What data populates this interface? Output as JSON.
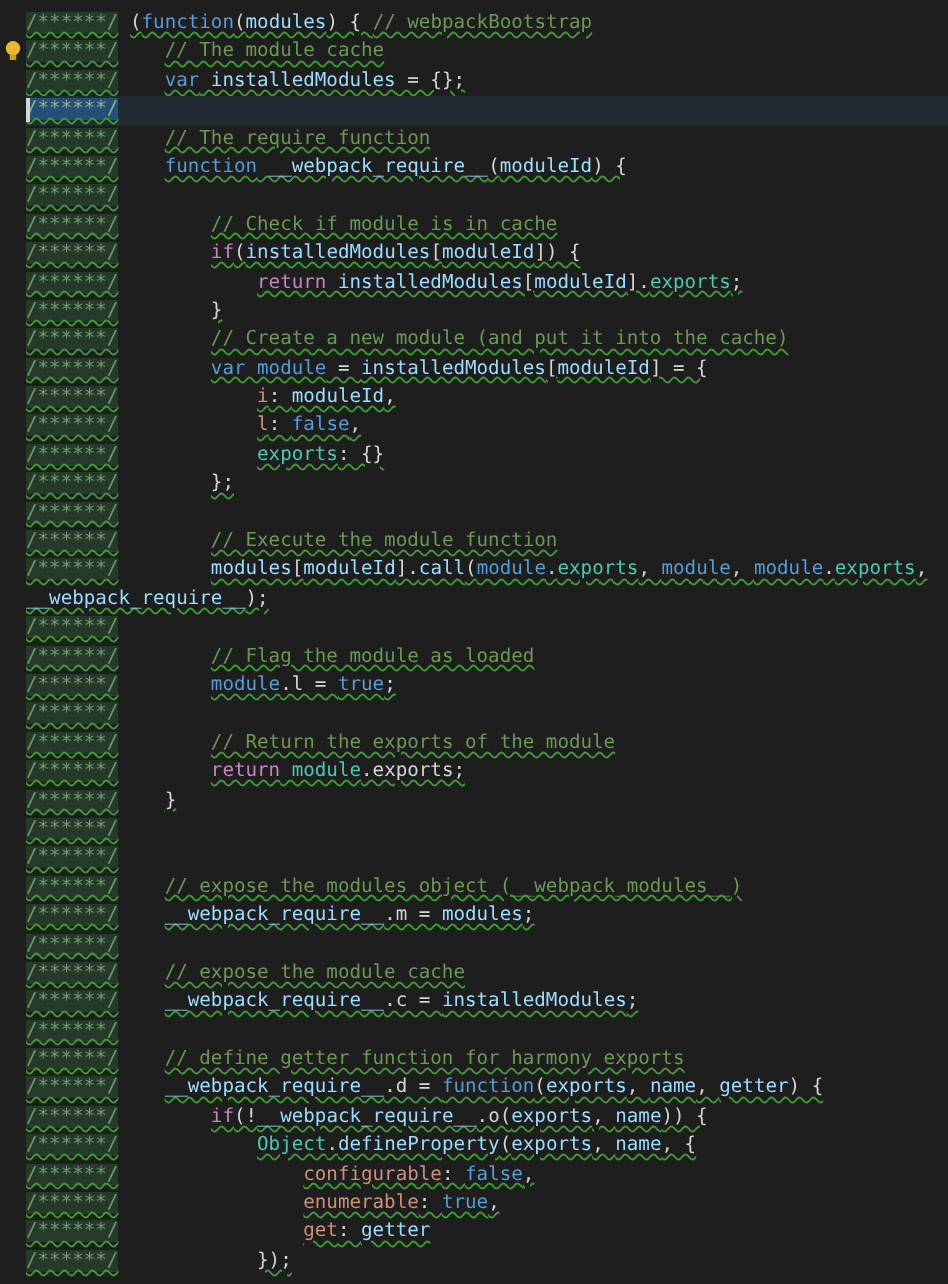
{
  "lines": [
    {
      "gutter": "/******/",
      "selected": false,
      "lightbulb": false,
      "tokens": [
        {
          "kind": "plain",
          "text": "("
        },
        {
          "kind": "keyword",
          "text": "function"
        },
        {
          "kind": "plain",
          "text": "("
        },
        {
          "kind": "variable",
          "text": "modules"
        },
        {
          "kind": "plain",
          "text": ") { "
        },
        {
          "kind": "comment",
          "text": "// webpackBootstrap"
        }
      ]
    },
    {
      "gutter": "/******/",
      "selected": false,
      "lightbulb": true,
      "tokens": [
        {
          "kind": "comment",
          "text": "\t// The module cache"
        }
      ]
    },
    {
      "gutter": "/******/",
      "selected": false,
      "lightbulb": false,
      "tokens": [
        {
          "kind": "keyword",
          "text": "\tvar"
        },
        {
          "kind": "variable",
          "text": " installedModules"
        },
        {
          "kind": "plain",
          "text": " = {};"
        }
      ]
    },
    {
      "gutter": "/******/",
      "selected": true,
      "lightbulb": false
    },
    {
      "gutter": "/******/",
      "selected": false,
      "lightbulb": false,
      "tokens": [
        {
          "kind": "comment",
          "text": "\t// The require function"
        }
      ]
    },
    {
      "gutter": "/******/",
      "selected": false,
      "lightbulb": false,
      "tokens": [
        {
          "kind": "keyword",
          "text": "\tfunction"
        },
        {
          "kind": "variable",
          "text": " __webpack_require__"
        },
        {
          "kind": "plain",
          "text": "("
        },
        {
          "kind": "variable",
          "text": "moduleId"
        },
        {
          "kind": "plain",
          "text": ") {"
        }
      ]
    },
    {
      "gutter": "/******/",
      "selected": false,
      "lightbulb": false
    },
    {
      "gutter": "/******/",
      "selected": false,
      "lightbulb": false,
      "tokens": [
        {
          "kind": "comment",
          "text": "\t\t// Check if module is in cache"
        }
      ]
    },
    {
      "gutter": "/******/",
      "selected": false,
      "lightbulb": false,
      "tokens": [
        {
          "kind": "control",
          "text": "\t\tif"
        },
        {
          "kind": "plain",
          "text": "("
        },
        {
          "kind": "variable",
          "text": "installedModules"
        },
        {
          "kind": "plain",
          "text": "["
        },
        {
          "kind": "variable",
          "text": "moduleId"
        },
        {
          "kind": "plain",
          "text": "]) {"
        }
      ]
    },
    {
      "gutter": "/******/",
      "selected": false,
      "lightbulb": false,
      "tokens": [
        {
          "kind": "control",
          "text": "\t\t\treturn"
        },
        {
          "kind": "variable",
          "text": " installedModules"
        },
        {
          "kind": "plain",
          "text": "["
        },
        {
          "kind": "variable",
          "text": "moduleId"
        },
        {
          "kind": "plain",
          "text": "]."
        },
        {
          "kind": "type",
          "text": "exports"
        },
        {
          "kind": "plain",
          "text": ";"
        }
      ]
    },
    {
      "gutter": "/******/",
      "selected": false,
      "lightbulb": false,
      "tokens": [
        {
          "kind": "plain",
          "text": "\t\t}"
        }
      ]
    },
    {
      "gutter": "/******/",
      "selected": false,
      "lightbulb": false,
      "tokens": [
        {
          "kind": "comment",
          "text": "\t\t// Create a new module (and put it into the cache)"
        }
      ]
    },
    {
      "gutter": "/******/",
      "selected": false,
      "lightbulb": false,
      "tokens": [
        {
          "kind": "keyword",
          "text": "\t\tvar module"
        },
        {
          "kind": "plain",
          "text": " = "
        },
        {
          "kind": "variable",
          "text": "installedModules"
        },
        {
          "kind": "plain",
          "text": "["
        },
        {
          "kind": "variable",
          "text": "moduleId"
        },
        {
          "kind": "plain",
          "text": "] = {"
        }
      ]
    },
    {
      "gutter": "/******/",
      "selected": false,
      "lightbulb": false,
      "tokens": [
        {
          "kind": "property",
          "text": "\t\t\ti"
        },
        {
          "kind": "plain",
          "text": ": "
        },
        {
          "kind": "variable",
          "text": "moduleId"
        },
        {
          "kind": "plain",
          "text": ","
        }
      ]
    },
    {
      "gutter": "/******/",
      "selected": false,
      "lightbulb": false,
      "tokens": [
        {
          "kind": "property",
          "text": "\t\t\tl"
        },
        {
          "kind": "plain",
          "text": ": "
        },
        {
          "kind": "keyword",
          "text": "false"
        },
        {
          "kind": "plain",
          "text": ","
        }
      ]
    },
    {
      "gutter": "/******/",
      "selected": false,
      "lightbulb": false,
      "tokens": [
        {
          "kind": "type",
          "text": "\t\t\texports"
        },
        {
          "kind": "plain",
          "text": ": {}"
        }
      ]
    },
    {
      "gutter": "/******/",
      "selected": false,
      "lightbulb": false,
      "tokens": [
        {
          "kind": "plain",
          "text": "\t\t};"
        }
      ]
    },
    {
      "gutter": "/******/",
      "selected": false,
      "lightbulb": false
    },
    {
      "gutter": "/******/",
      "selected": false,
      "lightbulb": false,
      "tokens": [
        {
          "kind": "comment",
          "text": "\t\t// Execute the module function"
        }
      ]
    },
    {
      "gutter": "/******/",
      "selected": false,
      "lightbulb": false,
      "tokens": [
        {
          "kind": "variable",
          "text": "\t\tmodules"
        },
        {
          "kind": "plain",
          "text": "["
        },
        {
          "kind": "variable",
          "text": "moduleId"
        },
        {
          "kind": "plain",
          "text": "]."
        },
        {
          "kind": "variable",
          "text": "call"
        },
        {
          "kind": "plain",
          "text": "("
        },
        {
          "kind": "keyword",
          "text": "module"
        },
        {
          "kind": "plain",
          "text": "."
        },
        {
          "kind": "type",
          "text": "exports"
        },
        {
          "kind": "plain",
          "text": ", "
        },
        {
          "kind": "keyword",
          "text": "module"
        },
        {
          "kind": "plain",
          "text": ", "
        },
        {
          "kind": "keyword",
          "text": "module"
        },
        {
          "kind": "plain",
          "text": "."
        },
        {
          "kind": "type",
          "text": "exports"
        },
        {
          "kind": "plain",
          "text": ","
        }
      ]
    },
    {
      "selected": false,
      "lightbulb": false,
      "tokens": [
        {
          "kind": "variable",
          "text": "__webpack_require__"
        },
        {
          "kind": "plain",
          "text": ");"
        }
      ]
    },
    {
      "gutter": "/******/",
      "selected": false,
      "lightbulb": false
    },
    {
      "gutter": "/******/",
      "selected": false,
      "lightbulb": false,
      "tokens": [
        {
          "kind": "comment",
          "text": "\t\t// Flag the module as loaded"
        }
      ]
    },
    {
      "gutter": "/******/",
      "selected": false,
      "lightbulb": false,
      "tokens": [
        {
          "kind": "keyword",
          "text": "\t\tmodule"
        },
        {
          "kind": "plain",
          "text": ".l = "
        },
        {
          "kind": "keyword",
          "text": "true"
        },
        {
          "kind": "plain",
          "text": ";"
        }
      ]
    },
    {
      "gutter": "/******/",
      "selected": false,
      "lightbulb": false
    },
    {
      "gutter": "/******/",
      "selected": false,
      "lightbulb": false,
      "tokens": [
        {
          "kind": "comment",
          "text": "\t\t// Return the exports of the module"
        }
      ]
    },
    {
      "gutter": "/******/",
      "selected": false,
      "lightbulb": false,
      "tokens": [
        {
          "kind": "control",
          "text": "\t\treturn"
        },
        {
          "kind": "type",
          "text": " module"
        },
        {
          "kind": "plain",
          "text": ".exports;"
        }
      ]
    },
    {
      "gutter": "/******/",
      "selected": false,
      "lightbulb": false,
      "tokens": [
        {
          "kind": "plain",
          "text": "\t}"
        }
      ]
    },
    {
      "gutter": "/******/",
      "selected": false,
      "lightbulb": false
    },
    {
      "gutter": "/******/",
      "selected": false,
      "lightbulb": false
    },
    {
      "gutter": "/******/",
      "selected": false,
      "lightbulb": false,
      "tokens": [
        {
          "kind": "comment",
          "text": "\t// expose the modules object (__webpack_modules__)"
        }
      ]
    },
    {
      "gutter": "/******/",
      "selected": false,
      "lightbulb": false,
      "tokens": [
        {
          "kind": "variable",
          "text": "\t__webpack_require__"
        },
        {
          "kind": "plain",
          "text": ".m = "
        },
        {
          "kind": "variable",
          "text": "modules"
        },
        {
          "kind": "plain",
          "text": ";"
        }
      ]
    },
    {
      "gutter": "/******/",
      "selected": false,
      "lightbulb": false
    },
    {
      "gutter": "/******/",
      "selected": false,
      "lightbulb": false,
      "tokens": [
        {
          "kind": "comment",
          "text": "\t// expose the module cache"
        }
      ]
    },
    {
      "gutter": "/******/",
      "selected": false,
      "lightbulb": false,
      "tokens": [
        {
          "kind": "variable",
          "text": "\t__webpack_require__"
        },
        {
          "kind": "plain",
          "text": ".c = "
        },
        {
          "kind": "variable",
          "text": "installedModules"
        },
        {
          "kind": "plain",
          "text": ";"
        }
      ]
    },
    {
      "gutter": "/******/",
      "selected": false,
      "lightbulb": false
    },
    {
      "gutter": "/******/",
      "selected": false,
      "lightbulb": false,
      "tokens": [
        {
          "kind": "comment",
          "text": "\t// define getter function for harmony exports"
        }
      ]
    },
    {
      "gutter": "/******/",
      "selected": false,
      "lightbulb": false,
      "tokens": [
        {
          "kind": "variable",
          "text": "\t__webpack_require__"
        },
        {
          "kind": "plain",
          "text": ".d = "
        },
        {
          "kind": "keyword",
          "text": "function"
        },
        {
          "kind": "plain",
          "text": "("
        },
        {
          "kind": "variable",
          "text": "exports"
        },
        {
          "kind": "plain",
          "text": ", "
        },
        {
          "kind": "variable",
          "text": "name"
        },
        {
          "kind": "plain",
          "text": ", "
        },
        {
          "kind": "variable",
          "text": "getter"
        },
        {
          "kind": "plain",
          "text": ") {"
        }
      ]
    },
    {
      "gutter": "/******/",
      "selected": false,
      "lightbulb": false,
      "tokens": [
        {
          "kind": "control",
          "text": "\t\tif"
        },
        {
          "kind": "plain",
          "text": "(!"
        },
        {
          "kind": "variable",
          "text": "__webpack_require__"
        },
        {
          "kind": "plain",
          "text": ".o("
        },
        {
          "kind": "variable",
          "text": "exports"
        },
        {
          "kind": "plain",
          "text": ", "
        },
        {
          "kind": "variable",
          "text": "name"
        },
        {
          "kind": "plain",
          "text": ")) {"
        }
      ]
    },
    {
      "gutter": "/******/",
      "selected": false,
      "lightbulb": false,
      "tokens": [
        {
          "kind": "type",
          "text": "\t\t\tObject"
        },
        {
          "kind": "plain",
          "text": "."
        },
        {
          "kind": "variable",
          "text": "defineProperty"
        },
        {
          "kind": "plain",
          "text": "("
        },
        {
          "kind": "variable",
          "text": "exports"
        },
        {
          "kind": "plain",
          "text": ", "
        },
        {
          "kind": "variable",
          "text": "name"
        },
        {
          "kind": "plain",
          "text": ", {"
        }
      ]
    },
    {
      "gutter": "/******/",
      "selected": false,
      "lightbulb": false,
      "tokens": [
        {
          "kind": "property",
          "text": "\t\t\t\tconfigurable"
        },
        {
          "kind": "plain",
          "text": ": "
        },
        {
          "kind": "keyword",
          "text": "false"
        },
        {
          "kind": "plain",
          "text": ","
        }
      ]
    },
    {
      "gutter": "/******/",
      "selected": false,
      "lightbulb": false,
      "tokens": [
        {
          "kind": "property",
          "text": "\t\t\t\tenumerable"
        },
        {
          "kind": "plain",
          "text": ": "
        },
        {
          "kind": "keyword",
          "text": "true"
        },
        {
          "kind": "plain",
          "text": ","
        }
      ]
    },
    {
      "gutter": "/******/",
      "selected": false,
      "lightbulb": false,
      "tokens": [
        {
          "kind": "property",
          "text": "\t\t\t\tget"
        },
        {
          "kind": "plain",
          "text": ": "
        },
        {
          "kind": "variable",
          "text": "getter"
        }
      ]
    },
    {
      "gutter": "/******/",
      "selected": false,
      "lightbulb": false,
      "tokens": [
        {
          "kind": "plain",
          "text": "\t\t\t});"
        }
      ]
    }
  ]
}
